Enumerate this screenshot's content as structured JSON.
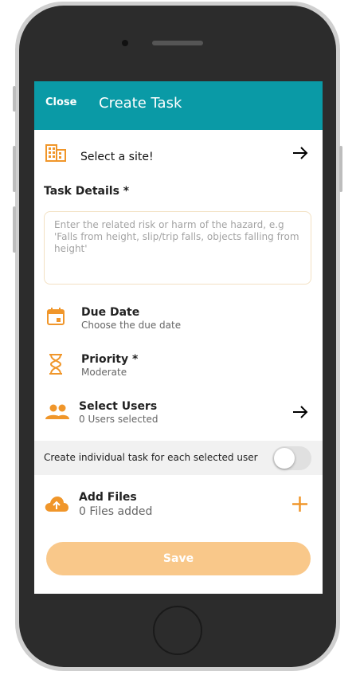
{
  "header": {
    "close_label": "Close",
    "title": "Create Task"
  },
  "site": {
    "label": "Select a site!",
    "icon": "building-icon"
  },
  "task_details": {
    "label": "Task Details *",
    "placeholder": "Enter the related risk or harm of the hazard, e.g 'Falls from height, slip/trip falls, objects falling from height'"
  },
  "due_date": {
    "label": "Due Date",
    "value": "Choose the due date",
    "icon": "calendar-icon"
  },
  "priority": {
    "label": "Priority *",
    "value": "Moderate",
    "icon": "hourglass-icon"
  },
  "users": {
    "label": "Select Users",
    "value": "0 Users selected",
    "icon": "people-icon"
  },
  "individual_task": {
    "label": "Create individual task for each selected user",
    "enabled": false
  },
  "files": {
    "label": "Add Files",
    "value": "0 Files added",
    "icon": "cloud-upload-icon"
  },
  "save_label": "Save",
  "colors": {
    "header": "#0a9aa6",
    "accent": "#f0962a",
    "save": "#f9c88a"
  }
}
